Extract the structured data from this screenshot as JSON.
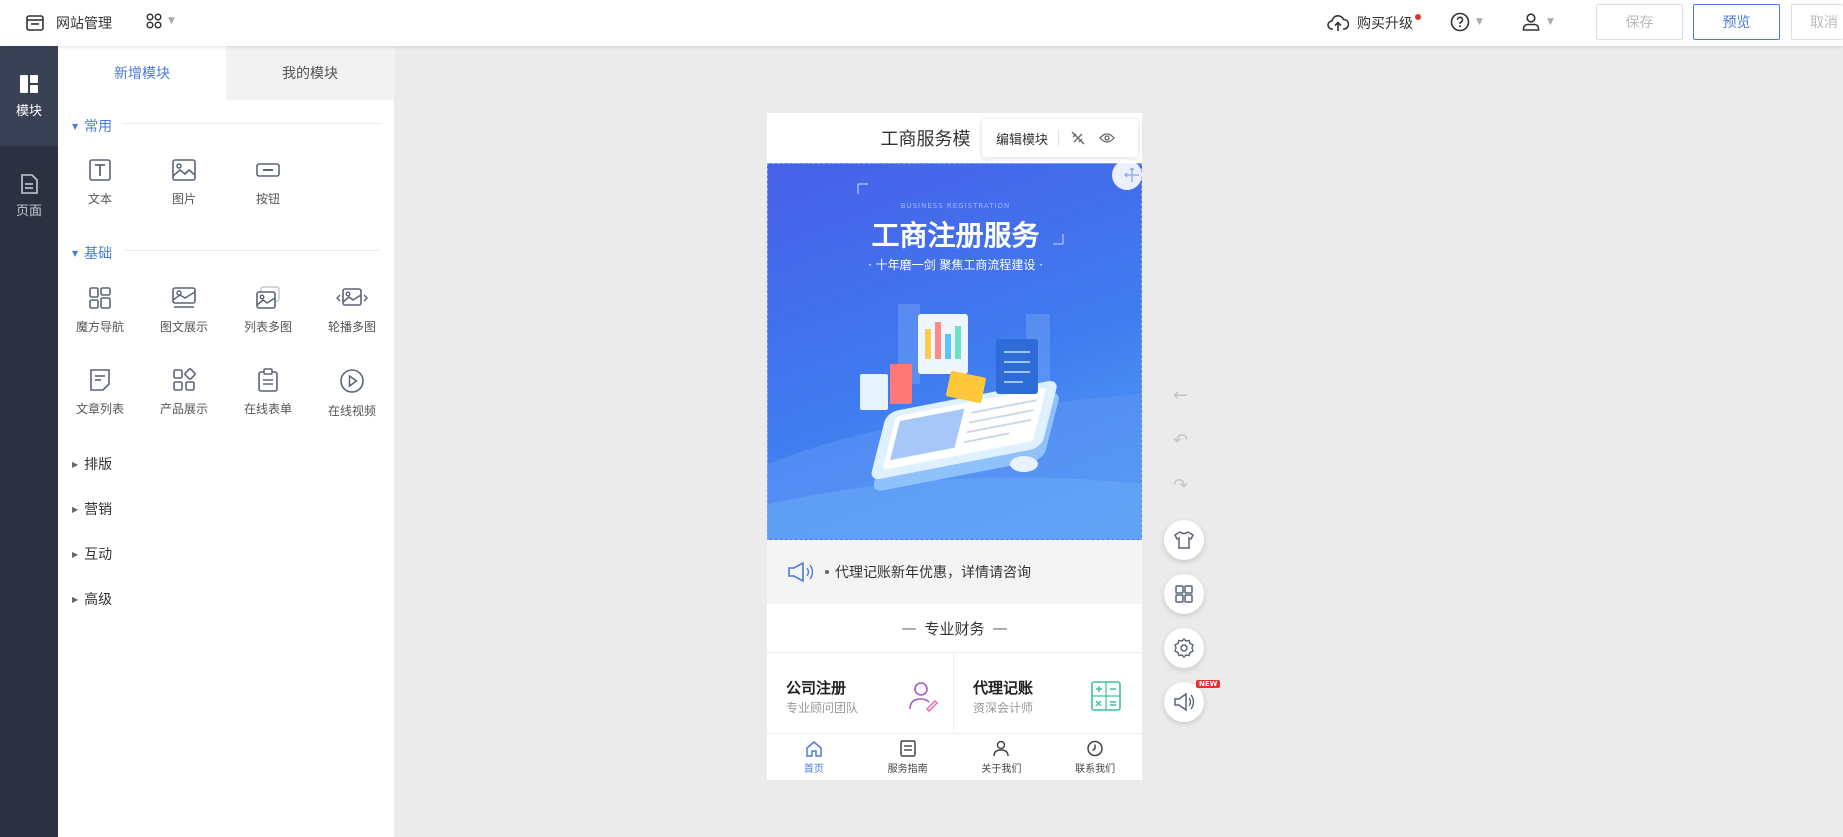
{
  "topbar": {
    "site_manage": "网站管理",
    "buy_upgrade": "购买升级",
    "save": "保存",
    "preview": "预览",
    "cancel": "取消"
  },
  "rail": {
    "modules": "模块",
    "pages": "页面"
  },
  "panel": {
    "tab_new": "新增模块",
    "tab_mine": "我的模块",
    "sections": {
      "common": "常用",
      "basic": "基础",
      "layout": "排版",
      "marketing": "营销",
      "interaction": "互动",
      "advanced": "高级"
    },
    "common_items": [
      "文本",
      "图片",
      "按钮"
    ],
    "basic_items": [
      "魔方导航",
      "图文展示",
      "列表多图",
      "轮播多图",
      "文章列表",
      "产品展示",
      "在线表单",
      "在线视频"
    ]
  },
  "phone": {
    "header_title": "工商服务模",
    "edit_module": "编辑模块",
    "banner_title": "工商注册服务",
    "banner_subtitle": "· 十年磨一剑 聚焦工商流程建设 ·",
    "banner_small": "BUSINESS REGISTRATION",
    "notice": "代理记账新年优惠，详情请咨询",
    "section_title": "专业财务",
    "cards": [
      {
        "title": "公司注册",
        "sub": "专业顾问团队"
      },
      {
        "title": "代理记账",
        "sub": "资深会计师"
      }
    ],
    "tabbar": [
      "首页",
      "服务指南",
      "关于我们",
      "联系我们"
    ]
  },
  "badges": {
    "new": "NEW"
  },
  "colors": {
    "accent": "#4a7bdc",
    "rail_bg": "#2c3141",
    "banner": "#4366ec",
    "notify_dot": "#e5322d"
  }
}
